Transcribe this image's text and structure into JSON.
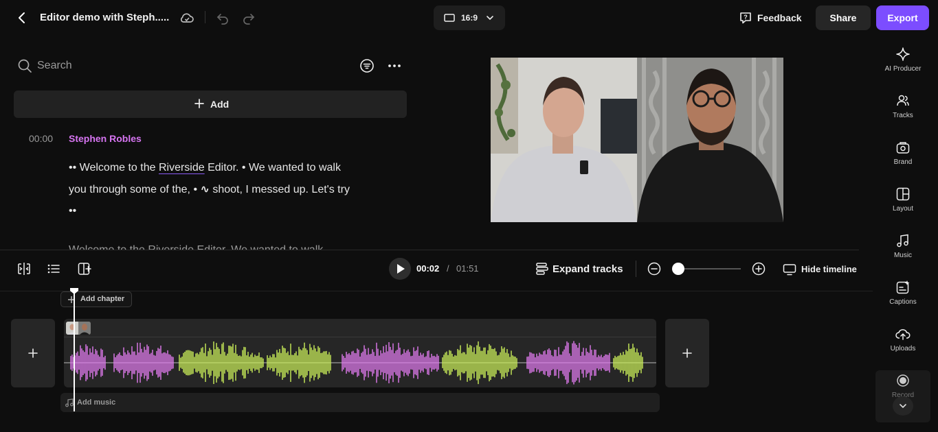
{
  "header": {
    "title": "Editor demo with Steph.....",
    "aspect_ratio": "16:9",
    "feedback_label": "Feedback",
    "share_label": "Share",
    "export_label": "Export",
    "export_color": "#7c4dff"
  },
  "search": {
    "placeholder": "Search"
  },
  "add_label": "Add",
  "transcript": {
    "time": "00:00",
    "speaker": "Stephen Robles",
    "speaker_color": "#d775f2",
    "segments": {
      "a": "•• Welcome to the ",
      "b": "Riverside",
      "c": " Editor. • We wanted to walk you through some of the, • ",
      "d": "∿",
      "e": " shoot, I messed up. Let's try ••"
    },
    "next_line": "Welcome to the Riverside Editor. We wanted to walk"
  },
  "rail": {
    "items": [
      {
        "label": "AI Producer",
        "icon": "sparkle-icon"
      },
      {
        "label": "Tracks",
        "icon": "users-icon"
      },
      {
        "label": "Brand",
        "icon": "brand-icon"
      },
      {
        "label": "Layout",
        "icon": "layout-icon"
      },
      {
        "label": "Music",
        "icon": "music-note-icon"
      },
      {
        "label": "Captions",
        "icon": "captions-icon"
      },
      {
        "label": "Uploads",
        "icon": "upload-cloud-icon"
      },
      {
        "label": "Record",
        "icon": "record-icon"
      }
    ]
  },
  "playback": {
    "current": "00:02",
    "separator": "/",
    "duration": "01:51",
    "expand_label": "Expand tracks",
    "hide_label": "Hide timeline",
    "zoom_level": 0.1
  },
  "timeline": {
    "add_chapter": "Add chapter",
    "add_music": "Add music",
    "wave_colors": {
      "speaker_1": "#e27bf0",
      "speaker_2": "#cdf25a"
    }
  }
}
